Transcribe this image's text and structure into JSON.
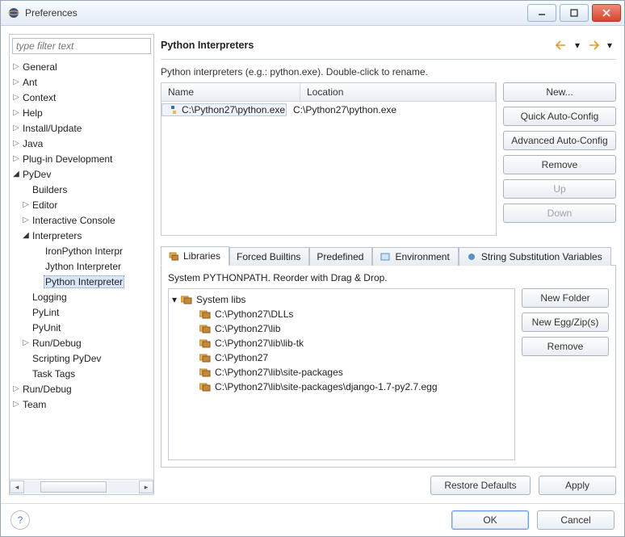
{
  "window": {
    "title": "Preferences"
  },
  "filter": {
    "placeholder": "type filter text"
  },
  "tree": {
    "items": [
      {
        "exp": ">",
        "label": "General",
        "indent": 0
      },
      {
        "exp": ">",
        "label": "Ant",
        "indent": 0
      },
      {
        "exp": ">",
        "label": "Context",
        "indent": 0
      },
      {
        "exp": ">",
        "label": "Help",
        "indent": 0
      },
      {
        "exp": ">",
        "label": "Install/Update",
        "indent": 0
      },
      {
        "exp": ">",
        "label": "Java",
        "indent": 0
      },
      {
        "exp": ">",
        "label": "Plug-in Development",
        "indent": 0
      },
      {
        "exp": "v",
        "label": "PyDev",
        "indent": 0
      },
      {
        "exp": "",
        "label": "Builders",
        "indent": 1
      },
      {
        "exp": ">",
        "label": "Editor",
        "indent": 1
      },
      {
        "exp": ">",
        "label": "Interactive Console",
        "indent": 1
      },
      {
        "exp": "v",
        "label": "Interpreters",
        "indent": 1
      },
      {
        "exp": "",
        "label": "IronPython Interpr",
        "indent": 2
      },
      {
        "exp": "",
        "label": "Jython Interpreter",
        "indent": 2
      },
      {
        "exp": "",
        "label": "Python Interpreter",
        "indent": 2,
        "selected": true
      },
      {
        "exp": "",
        "label": "Logging",
        "indent": 1
      },
      {
        "exp": "",
        "label": "PyLint",
        "indent": 1
      },
      {
        "exp": "",
        "label": "PyUnit",
        "indent": 1
      },
      {
        "exp": ">",
        "label": "Run/Debug",
        "indent": 1
      },
      {
        "exp": "",
        "label": "Scripting PyDev",
        "indent": 1
      },
      {
        "exp": "",
        "label": "Task Tags",
        "indent": 1
      },
      {
        "exp": ">",
        "label": "Run/Debug",
        "indent": 0
      },
      {
        "exp": ">",
        "label": "Team",
        "indent": 0
      }
    ]
  },
  "header": {
    "title": "Python Interpreters"
  },
  "subtext": "Python interpreters (e.g.: python.exe).   Double-click to rename.",
  "interp_table": {
    "col_name": "Name",
    "col_location": "Location",
    "rows": [
      {
        "name": "C:\\Python27\\python.exe",
        "location": "C:\\Python27\\python.exe"
      }
    ]
  },
  "sidebuttons": {
    "new_": "New...",
    "quick": "Quick Auto-Config",
    "advanced": "Advanced Auto-Config",
    "remove": "Remove",
    "up": "Up",
    "down": "Down"
  },
  "tabs": {
    "libraries": "Libraries",
    "forced": "Forced Builtins",
    "predefined": "Predefined",
    "environment": "Environment",
    "stringsub": "String Substitution Variables"
  },
  "tab_hint": "System PYTHONPATH.   Reorder with Drag & Drop.",
  "libs": {
    "root": "System libs",
    "paths": [
      "C:\\Python27\\DLLs",
      "C:\\Python27\\lib",
      "C:\\Python27\\lib\\lib-tk",
      "C:\\Python27",
      "C:\\Python27\\lib\\site-packages",
      "C:\\Python27\\lib\\site-packages\\django-1.7-py2.7.egg"
    ]
  },
  "libbuttons": {
    "newfolder": "New Folder",
    "newegg": "New Egg/Zip(s)",
    "remove": "Remove"
  },
  "bottom": {
    "restore": "Restore Defaults",
    "apply": "Apply"
  },
  "dlg": {
    "ok": "OK",
    "cancel": "Cancel"
  }
}
